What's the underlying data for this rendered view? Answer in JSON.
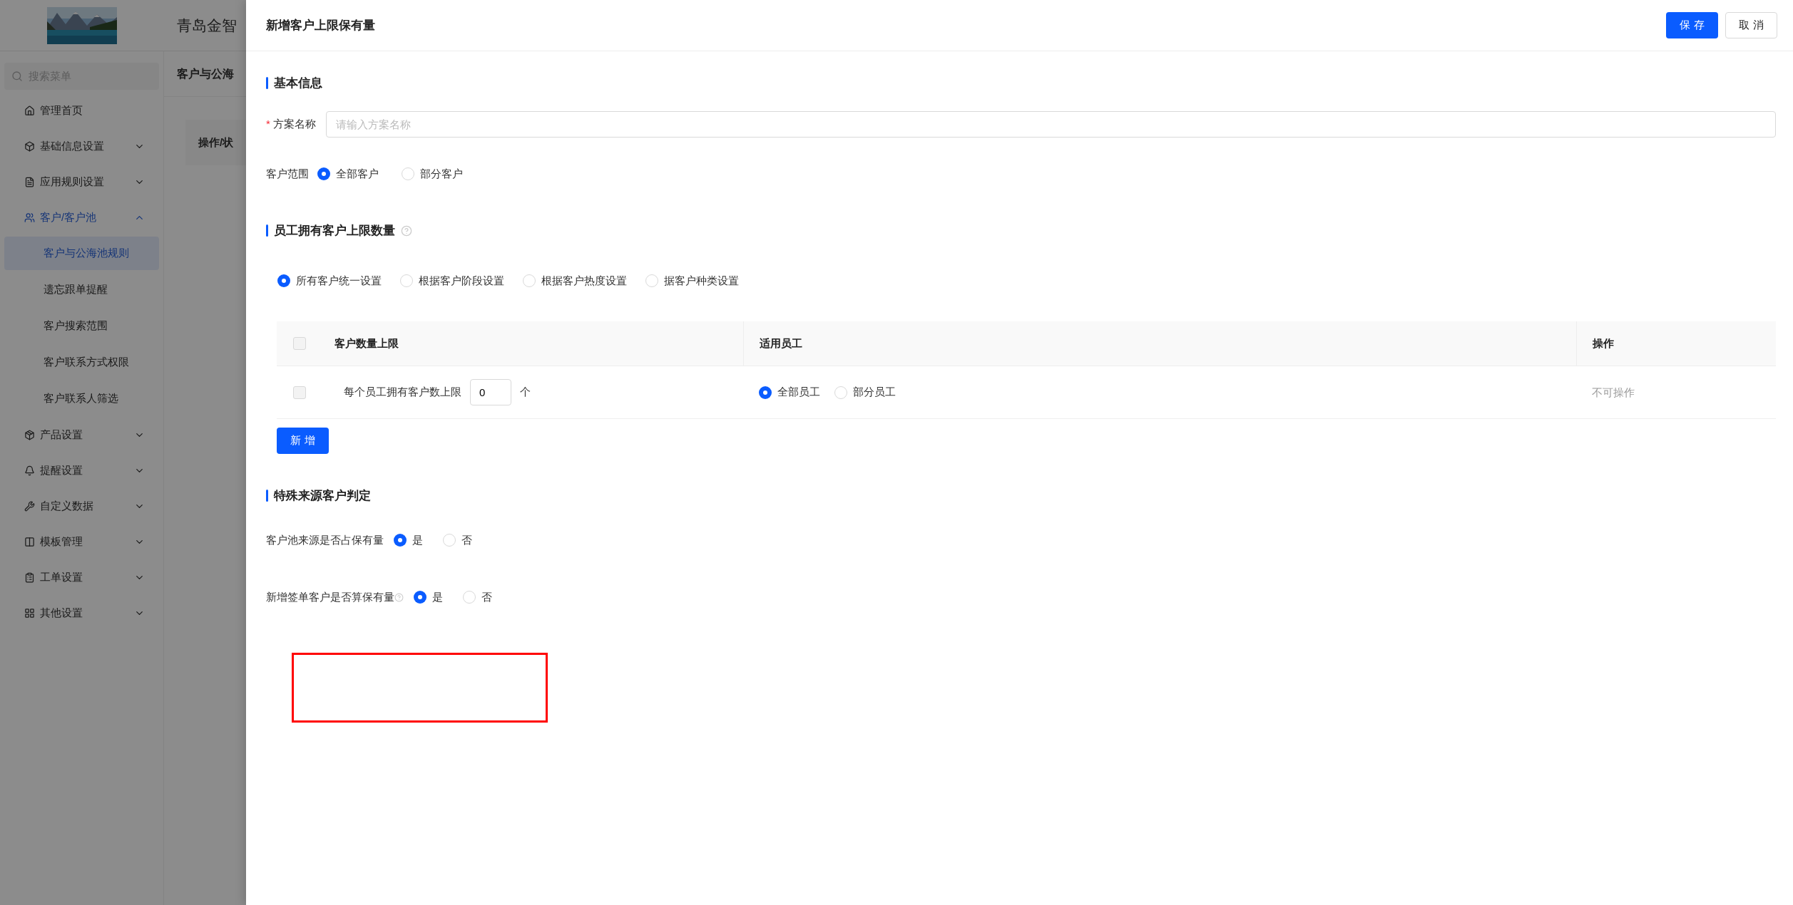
{
  "app": {
    "title": "青岛金智",
    "breadcrumb": "客户与公海",
    "column_header": "操作/状"
  },
  "sidebar": {
    "search_placeholder": "搜索菜单",
    "items": [
      {
        "label": "管理首页",
        "kind": "link"
      },
      {
        "label": "基础信息设置",
        "kind": "group",
        "expanded": false
      },
      {
        "label": "应用规则设置",
        "kind": "group",
        "expanded": false
      },
      {
        "label": "客户/客户池",
        "kind": "group",
        "expanded": true,
        "children": [
          {
            "label": "客户与公海池规则",
            "selected": true
          },
          {
            "label": "遗忘跟单提醒",
            "selected": false
          },
          {
            "label": "客户搜索范围",
            "selected": false
          },
          {
            "label": "客户联系方式权限",
            "selected": false
          },
          {
            "label": "客户联系人筛选",
            "selected": false
          }
        ]
      },
      {
        "label": "产品设置",
        "kind": "group",
        "expanded": false
      },
      {
        "label": "提醒设置",
        "kind": "group",
        "expanded": false
      },
      {
        "label": "自定义数据",
        "kind": "group",
        "expanded": false
      },
      {
        "label": "模板管理",
        "kind": "group",
        "expanded": false
      },
      {
        "label": "工单设置",
        "kind": "group",
        "expanded": false
      },
      {
        "label": "其他设置",
        "kind": "group",
        "expanded": false
      }
    ]
  },
  "drawer": {
    "title": "新增客户上限保有量",
    "buttons": [
      {
        "label": "保 存",
        "kind": "primary"
      },
      {
        "label": "取 消",
        "kind": "default"
      }
    ],
    "basic": {
      "heading": "基本信息",
      "name_field": {
        "label": "方案名称",
        "required_mark": "*",
        "placeholder": "请输入方案名称"
      },
      "scope": {
        "label": "客户范围",
        "options": [
          {
            "label": "全部客户",
            "selected": true
          },
          {
            "label": "部分客户",
            "selected": false
          }
        ]
      }
    },
    "limit": {
      "heading": "员工拥有客户上限数量",
      "help": true,
      "modes": [
        {
          "label": "所有客户统一设置",
          "selected": true
        },
        {
          "label": "根据客户阶段设置",
          "selected": false
        },
        {
          "label": "根据客户热度设置",
          "selected": false
        },
        {
          "label": "据客户种类设置",
          "selected": false
        }
      ],
      "table": {
        "all_checked": false,
        "columns": [
          "客户数量上限",
          "适用员工",
          "操作"
        ],
        "rows": [
          {
            "checked": false,
            "limit_label": "每个员工拥有客户数上限",
            "value": "0",
            "unit": "个",
            "staff": [
              {
                "label": "全部员工",
                "selected": true
              },
              {
                "label": "部分员工",
                "selected": false
              }
            ],
            "action": "不可操作",
            "action_disabled": true
          }
        ]
      },
      "add_button": "新 增"
    },
    "special": {
      "heading": "特殊来源客户判定",
      "questions": [
        {
          "label": "客户池来源是否占保有量",
          "help": false,
          "options": [
            {
              "label": "是",
              "selected": true
            },
            {
              "label": "否",
              "selected": false
            }
          ]
        },
        {
          "label": "新增签单客户是否算保有量",
          "help": true,
          "options": [
            {
              "label": "是",
              "selected": true
            },
            {
              "label": "否",
              "selected": false
            }
          ]
        }
      ]
    }
  }
}
